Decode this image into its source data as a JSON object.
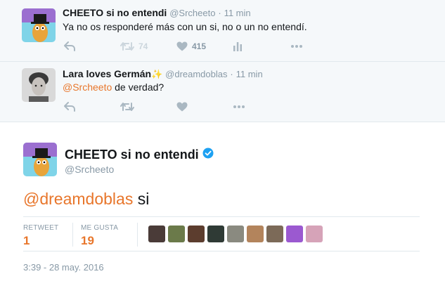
{
  "replies": [
    {
      "name": "CHEETO si no entendi",
      "handle": "@Srcheeto",
      "separator": "·",
      "time": "11 min",
      "text": "Ya no os responderé más con un si, no o un no entendí.",
      "actions": {
        "reply_icon": "reply-icon",
        "retweet_icon": "retweet-icon",
        "retweet_count": "74",
        "like_icon": "heart-icon",
        "like_count": "415",
        "analytics_icon": "bar-chart-icon",
        "more_icon": "more-dots-icon"
      }
    },
    {
      "name": "Lara loves Germán",
      "name_emoji": "✨",
      "handle": "@dreamdoblas",
      "separator": "·",
      "time": "11 min",
      "mention": "@Srcheeto",
      "text": " de verdad?",
      "actions": {
        "reply_icon": "reply-icon",
        "retweet_icon": "retweet-icon",
        "like_icon": "heart-icon",
        "more_icon": "more-dots-icon"
      }
    }
  ],
  "main_tweet": {
    "name": "CHEETO si no entendi",
    "verified_icon": "verified-badge-icon",
    "handle": "@Srcheeto",
    "mention": "@dreamdoblas",
    "text": " si",
    "stats": {
      "retweet_label": "RETWEET",
      "retweet_count": "1",
      "like_label": "ME GUSTA",
      "like_count": "19"
    },
    "likers_count": 9,
    "timestamp": "3:39 - 28 may. 2016"
  },
  "colors": {
    "accent": "#e8762b",
    "muted": "#8899a6",
    "reply_background": "#f5f8fa",
    "verified": "#1da1f2"
  }
}
